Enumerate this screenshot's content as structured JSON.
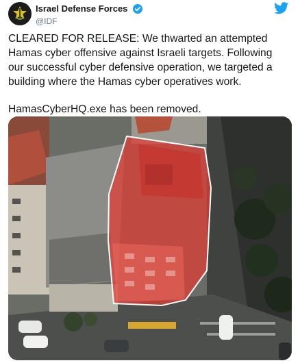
{
  "account": {
    "display_name": "Israel Defense Forces",
    "handle": "@IDF",
    "verified": true,
    "avatar_icon": "idf-emblem-icon"
  },
  "brand": {
    "icon": "twitter-bird-icon",
    "color": "#1da1f2"
  },
  "tweet": {
    "paragraph_1": "CLEARED FOR RELEASE: We thwarted an attempted Hamas cyber offensive against Israeli targets. Following our successful cyber defensive operation, we targeted a building where the Hamas cyber operatives work.",
    "paragraph_2": "HamasCyberHQ.exe has been removed."
  },
  "media": {
    "type": "aerial-photo",
    "highlight_color": "#e23b33"
  }
}
